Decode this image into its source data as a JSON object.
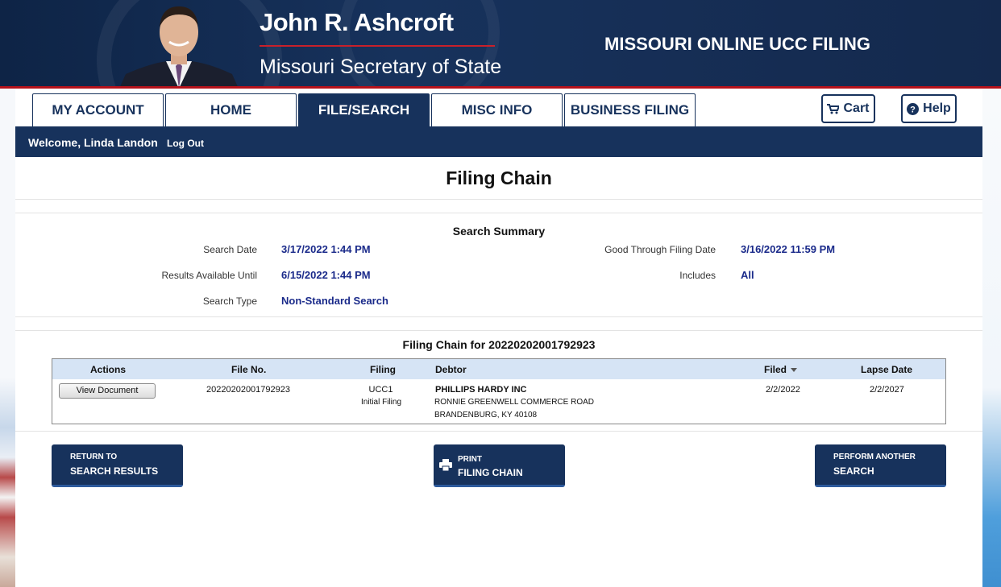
{
  "header": {
    "name": "John R. Ashcroft",
    "office": "Missouri Secretary of State",
    "app_title": "MISSOURI ONLINE UCC FILING"
  },
  "nav": {
    "tabs": [
      {
        "label": "MY ACCOUNT",
        "active": false
      },
      {
        "label": "HOME",
        "active": false
      },
      {
        "label": "FILE/SEARCH",
        "active": true
      },
      {
        "label": "MISC INFO",
        "active": false
      },
      {
        "label": "BUSINESS FILING",
        "active": false
      }
    ],
    "cart_label": "Cart",
    "help_label": "Help"
  },
  "welcome": {
    "text": "Welcome, Linda Landon",
    "logout": "Log Out"
  },
  "page": {
    "title": "Filing Chain"
  },
  "summary": {
    "title": "Search Summary",
    "search_date_label": "Search Date",
    "search_date": "3/17/2022 1:44 PM",
    "results_until_label": "Results Available Until",
    "results_until": "6/15/2022 1:44 PM",
    "search_type_label": "Search Type",
    "search_type": "Non-Standard Search",
    "good_through_label": "Good Through Filing Date",
    "good_through": "3/16/2022 11:59 PM",
    "includes_label": "Includes",
    "includes": "All"
  },
  "chain": {
    "title": "Filing Chain for 20220202001792923",
    "columns": [
      "Actions",
      "File No.",
      "Filing",
      "Debtor",
      "Filed",
      "Lapse Date"
    ],
    "rows": [
      {
        "action": "View Document",
        "file_no": "20220202001792923",
        "filing_type": "UCC1",
        "filing_desc": "Initial Filing",
        "debtor_name": "PHILLIPS HARDY INC",
        "debtor_addr1": "RONNIE GREENWELL COMMERCE ROAD",
        "debtor_addr2": "BRANDENBURG, KY 40108",
        "filed": "2/2/2022",
        "lapse": "2/2/2027"
      }
    ]
  },
  "actions": {
    "return_l1": "RETURN TO",
    "return_l2": "SEARCH RESULTS",
    "print_l1": "PRINT",
    "print_l2": "FILING CHAIN",
    "another_l1": "PERFORM ANOTHER",
    "another_l2": "SEARCH"
  },
  "colors": {
    "navy": "#17325c",
    "accent_red": "#b5121b",
    "value_blue": "#1a2a8a",
    "table_header": "#d6e4f5"
  }
}
